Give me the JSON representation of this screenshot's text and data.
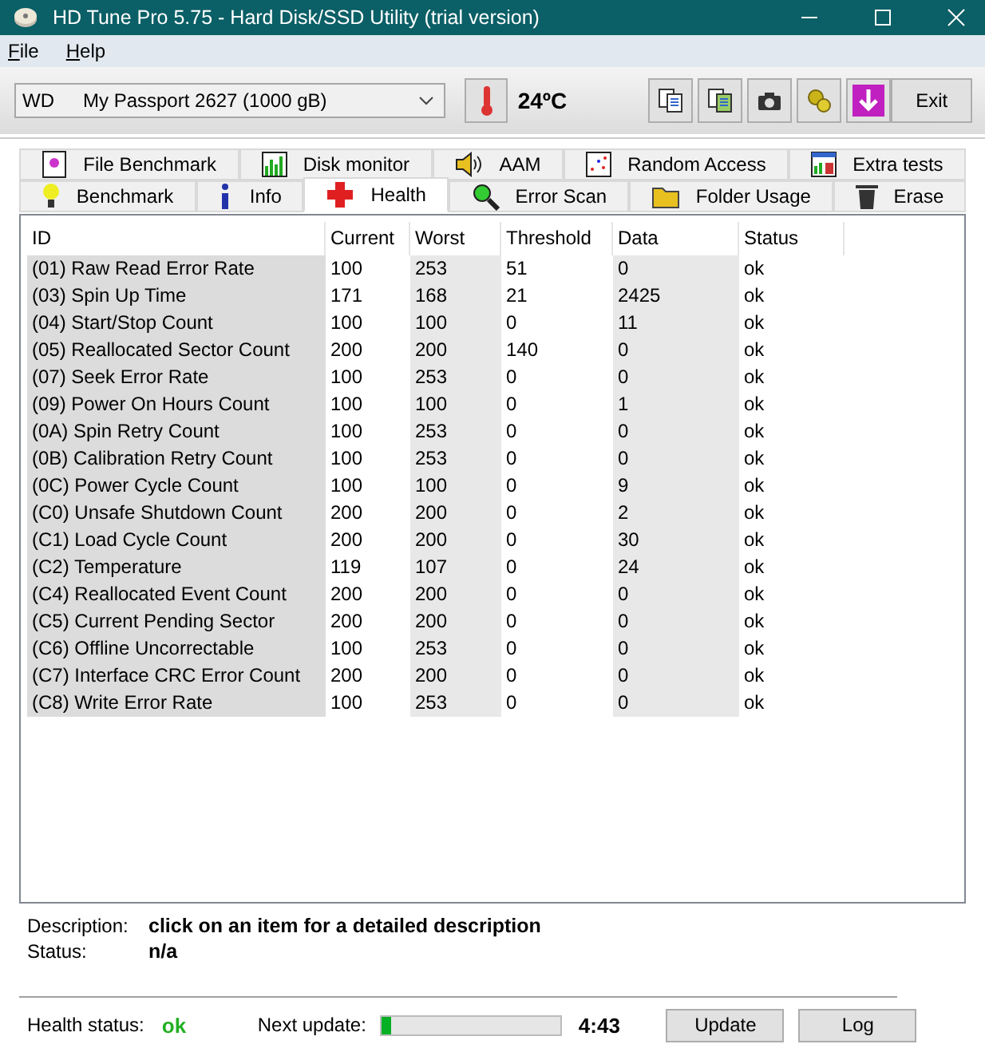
{
  "window": {
    "title": "HD Tune Pro 5.75 - Hard Disk/SSD Utility (trial version)"
  },
  "menu": [
    "File",
    "Help"
  ],
  "toolbar": {
    "drive": "WD",
    "drive_name": "My Passport 2627 (1000 gB)",
    "temperature": "24ºC",
    "tools": [
      {
        "kind": "copy"
      },
      {
        "kind": "copy-all"
      },
      {
        "kind": "camera"
      },
      {
        "kind": "gears"
      },
      {
        "kind": "download"
      }
    ],
    "exit": "Exit"
  },
  "tab_rows": [
    [
      {
        "label": "File Benchmark",
        "kind": "file",
        "selected": false
      },
      {
        "label": "Disk monitor",
        "kind": "monitor",
        "selected": false
      },
      {
        "label": "AAM",
        "kind": "speaker",
        "selected": false
      },
      {
        "label": "Random Access",
        "kind": "random",
        "selected": false
      },
      {
        "label": "Extra tests",
        "kind": "extra",
        "selected": false
      }
    ],
    [
      {
        "label": "Benchmark",
        "kind": "bulb",
        "selected": false
      },
      {
        "label": "Info",
        "kind": "info",
        "selected": false
      },
      {
        "label": "Health",
        "kind": "health",
        "selected": true
      },
      {
        "label": "Error Scan",
        "kind": "scan",
        "selected": false
      },
      {
        "label": "Folder Usage",
        "kind": "folder",
        "selected": false
      },
      {
        "label": "Erase",
        "kind": "trash",
        "selected": false
      }
    ]
  ],
  "table": {
    "columns": [
      "ID",
      "Current",
      "Worst",
      "Threshold",
      "Data",
      "Status"
    ],
    "rows": [
      [
        "(01) Raw Read Error Rate",
        "100",
        "253",
        "51",
        "0",
        "ok"
      ],
      [
        "(03) Spin Up Time",
        "171",
        "168",
        "21",
        "2425",
        "ok"
      ],
      [
        "(04) Start/Stop Count",
        "100",
        "100",
        "0",
        "11",
        "ok"
      ],
      [
        "(05) Reallocated Sector Count",
        "200",
        "200",
        "140",
        "0",
        "ok"
      ],
      [
        "(07) Seek Error Rate",
        "100",
        "253",
        "0",
        "0",
        "ok"
      ],
      [
        "(09) Power On Hours Count",
        "100",
        "100",
        "0",
        "1",
        "ok"
      ],
      [
        "(0A) Spin Retry Count",
        "100",
        "253",
        "0",
        "0",
        "ok"
      ],
      [
        "(0B) Calibration Retry Count",
        "100",
        "253",
        "0",
        "0",
        "ok"
      ],
      [
        "(0C) Power Cycle Count",
        "100",
        "100",
        "0",
        "9",
        "ok"
      ],
      [
        "(C0) Unsafe Shutdown Count",
        "200",
        "200",
        "0",
        "2",
        "ok"
      ],
      [
        "(C1) Load Cycle Count",
        "200",
        "200",
        "0",
        "30",
        "ok"
      ],
      [
        "(C2) Temperature",
        "119",
        "107",
        "0",
        "24",
        "ok"
      ],
      [
        "(C4) Reallocated Event Count",
        "200",
        "200",
        "0",
        "0",
        "ok"
      ],
      [
        "(C5) Current Pending Sector",
        "200",
        "200",
        "0",
        "0",
        "ok"
      ],
      [
        "(C6) Offline Uncorrectable",
        "100",
        "253",
        "0",
        "0",
        "ok"
      ],
      [
        "(C7) Interface CRC Error Count",
        "200",
        "200",
        "0",
        "0",
        "ok"
      ],
      [
        "(C8) Write Error Rate",
        "100",
        "253",
        "0",
        "0",
        "ok"
      ]
    ]
  },
  "details": [
    {
      "label": "Description:",
      "value": "click on an item for a detailed description"
    },
    {
      "label": "Status:",
      "value": "n/a"
    }
  ],
  "footer": {
    "health_label": "Health status:",
    "health_value": "ok",
    "next_label": "Next update:",
    "progress": {
      "level": 0.05
    },
    "countdown": "4:43",
    "buttons": [
      "Update",
      "Log"
    ]
  }
}
